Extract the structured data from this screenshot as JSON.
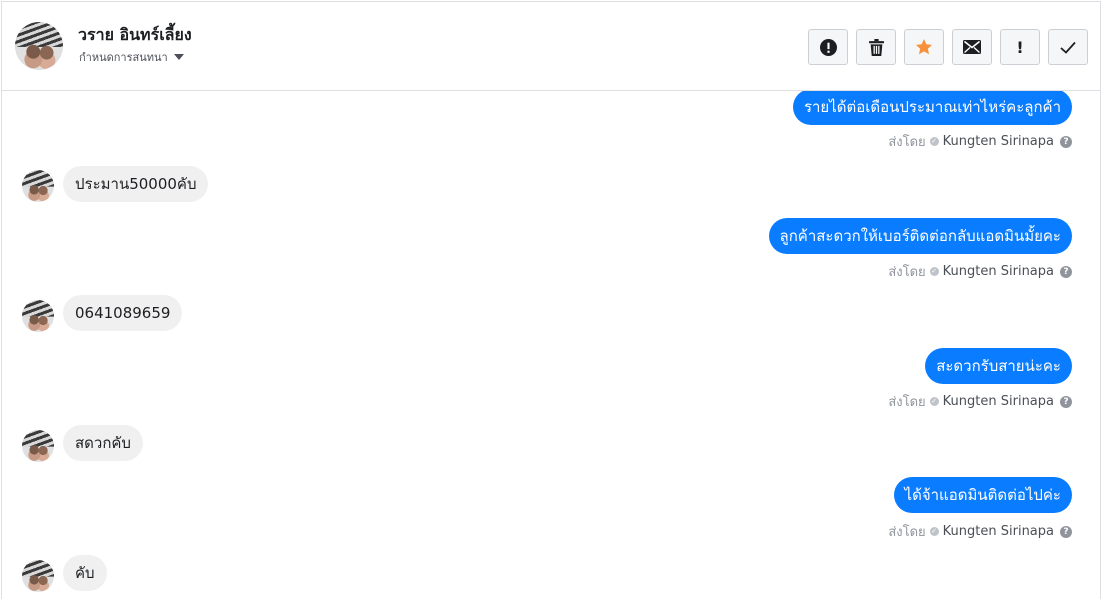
{
  "header": {
    "contact_name": "วราย อินทร์เลี้ยง",
    "assign_label": "กำหนดการสนทนา",
    "actions": {
      "spam_icon": "exclamation-circle-icon",
      "delete_icon": "trash-icon",
      "star_icon": "star-icon",
      "mail_icon": "envelope-icon",
      "follow_up_label": "!",
      "done_icon": "checkmark-icon"
    }
  },
  "colors": {
    "outgoing_bubble": "#0a7cff",
    "incoming_bubble": "#f0f0f0",
    "star": "#f7923a"
  },
  "sender_prefix": "ส่งโดย",
  "sender_name": "Kungten Sirinapa",
  "messages": [
    {
      "direction": "out",
      "text": "รายได้ต่อเดือนประมาณเท่าไหร่คะลูกค้า"
    },
    {
      "direction": "in",
      "text": "ประมาน50000คับ"
    },
    {
      "direction": "out",
      "text": "ลูกค้าสะดวกให้เบอร์ติดต่อกลับแอดมินมั้ยคะ"
    },
    {
      "direction": "in",
      "text": "0641089659"
    },
    {
      "direction": "out",
      "text": "สะดวกรับสายน่ะคะ"
    },
    {
      "direction": "in",
      "text": "สดวกคับ"
    },
    {
      "direction": "out",
      "text": "ได้จ้าแอดมินติดต่อไปค่ะ"
    },
    {
      "direction": "in",
      "text": "คับ"
    }
  ]
}
